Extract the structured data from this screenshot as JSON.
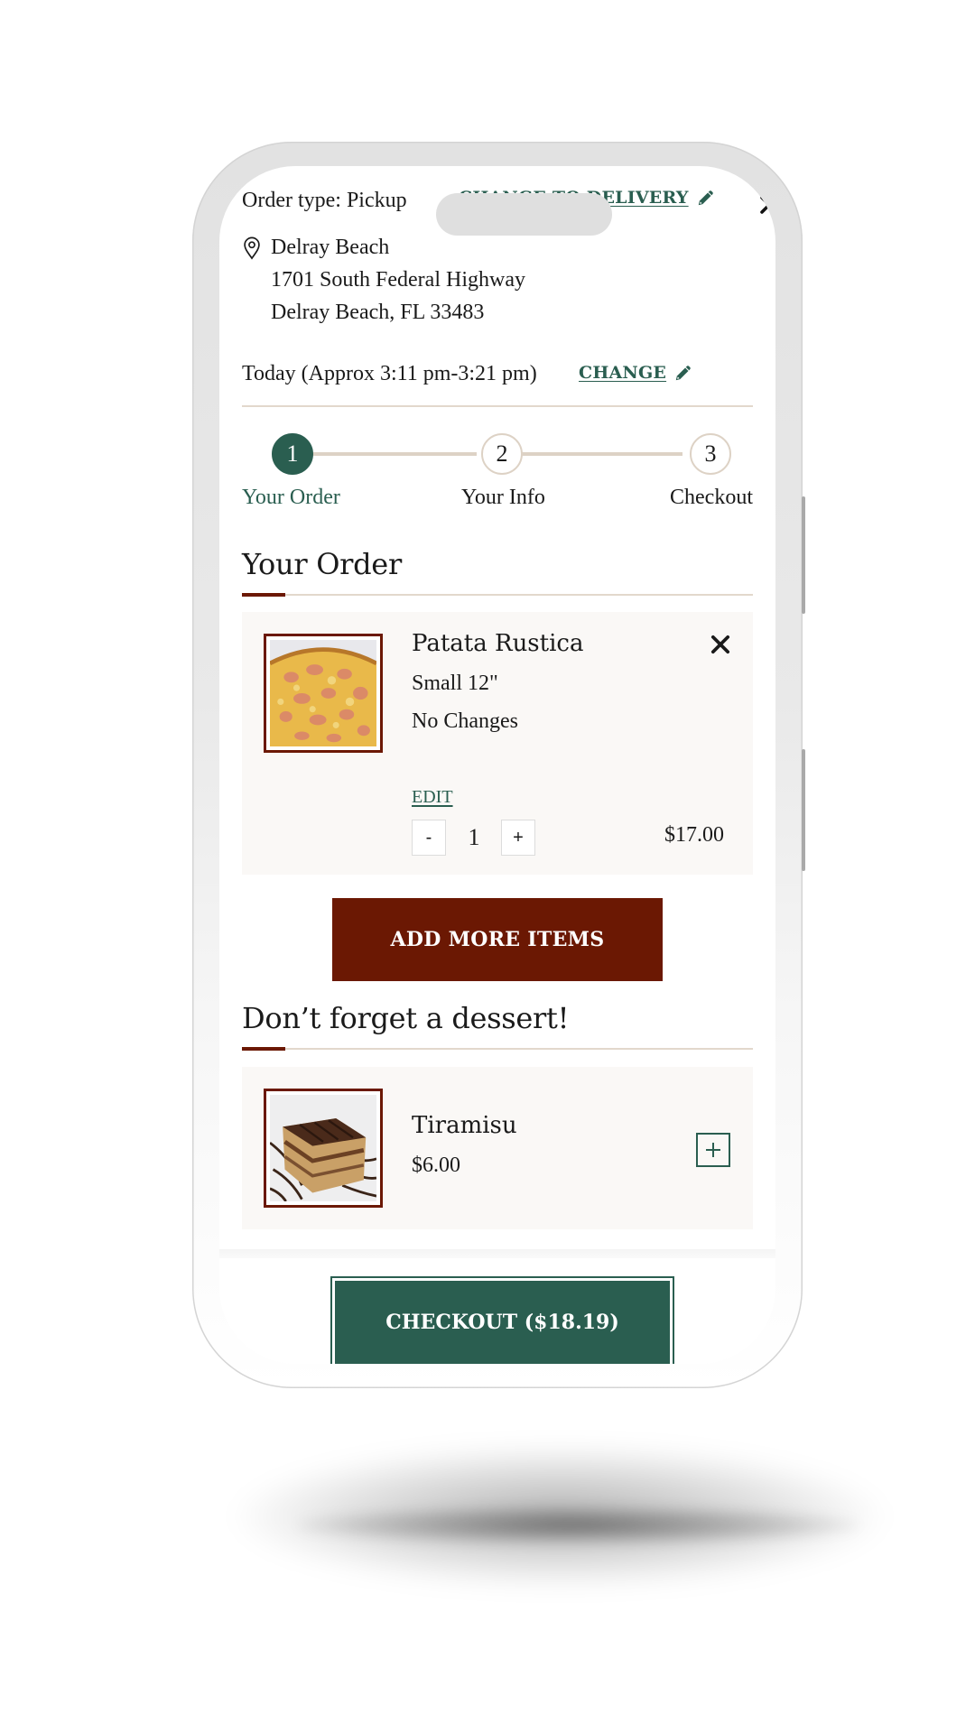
{
  "colors": {
    "brand_green": "#2a5e50",
    "brand_red": "#6b1803",
    "divider": "#e2d8cc",
    "card_bg": "#faf8f6"
  },
  "header": {
    "order_type_label": "Order type: Pickup",
    "change_order_type": "CHANGE TO DELIVERY",
    "close_icon": "close-icon"
  },
  "location": {
    "icon": "map-pin-icon",
    "name": "Delray Beach",
    "street": "1701 South Federal Highway",
    "city_state_zip": "Delray Beach, FL 33483"
  },
  "pickup_time": {
    "text": "Today (Approx 3:11 pm-3:21 pm)",
    "change_label": "CHANGE",
    "edit_icon": "pencil-icon"
  },
  "stepper": {
    "current_step": 1,
    "steps": [
      {
        "number": "1",
        "label": "Your Order"
      },
      {
        "number": "2",
        "label": "Your Info"
      },
      {
        "number": "3",
        "label": "Checkout"
      }
    ]
  },
  "order": {
    "title": "Your Order",
    "items": [
      {
        "name": "Patata Rustica",
        "size": "Small 12\"",
        "modifications": "No Changes",
        "edit_label": "EDIT",
        "quantity": "1",
        "decrement_label": "-",
        "increment_label": "+",
        "price": "$17.00",
        "image": "pizza-photo"
      }
    ],
    "add_more_label": "ADD MORE ITEMS"
  },
  "upsell": {
    "title": "Don’t forget a dessert!",
    "items": [
      {
        "name": "Tiramisu",
        "price": "$6.00",
        "image": "tiramisu-photo",
        "add_icon": "plus-icon"
      }
    ]
  },
  "footer": {
    "checkout_label": "CHECKOUT ($18.19)"
  }
}
